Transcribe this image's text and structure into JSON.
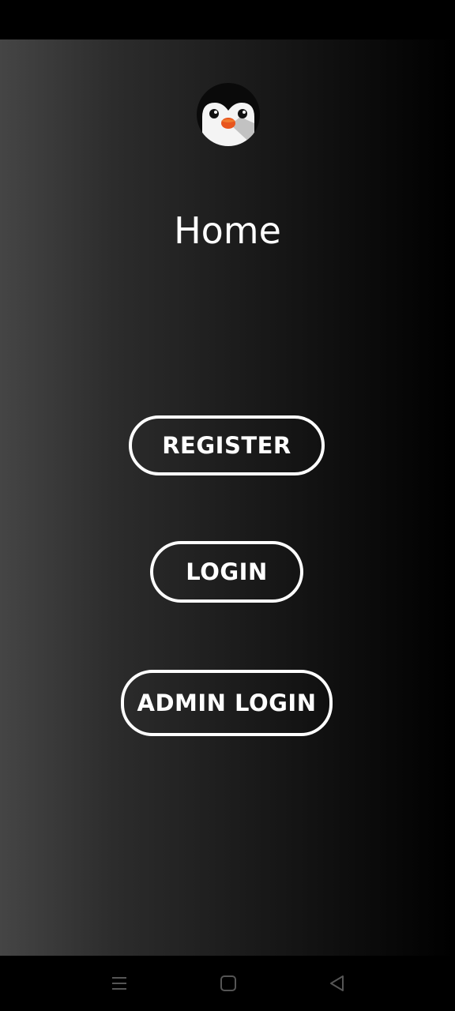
{
  "screen": {
    "title": "Home",
    "logo_icon": "penguin-logo-icon"
  },
  "buttons": {
    "register_label": "REGISTER",
    "login_label": "LOGIN",
    "admin_login_label": "ADMIN LOGIN"
  },
  "nav_bar": {
    "icons": [
      "menu-icon",
      "home-square-icon",
      "back-triangle-icon"
    ]
  },
  "colors": {
    "background_start": "#454545",
    "background_end": "#000000",
    "text": "#ffffff",
    "button_border": "#ffffff",
    "penguin_beak": "#e8561e"
  }
}
